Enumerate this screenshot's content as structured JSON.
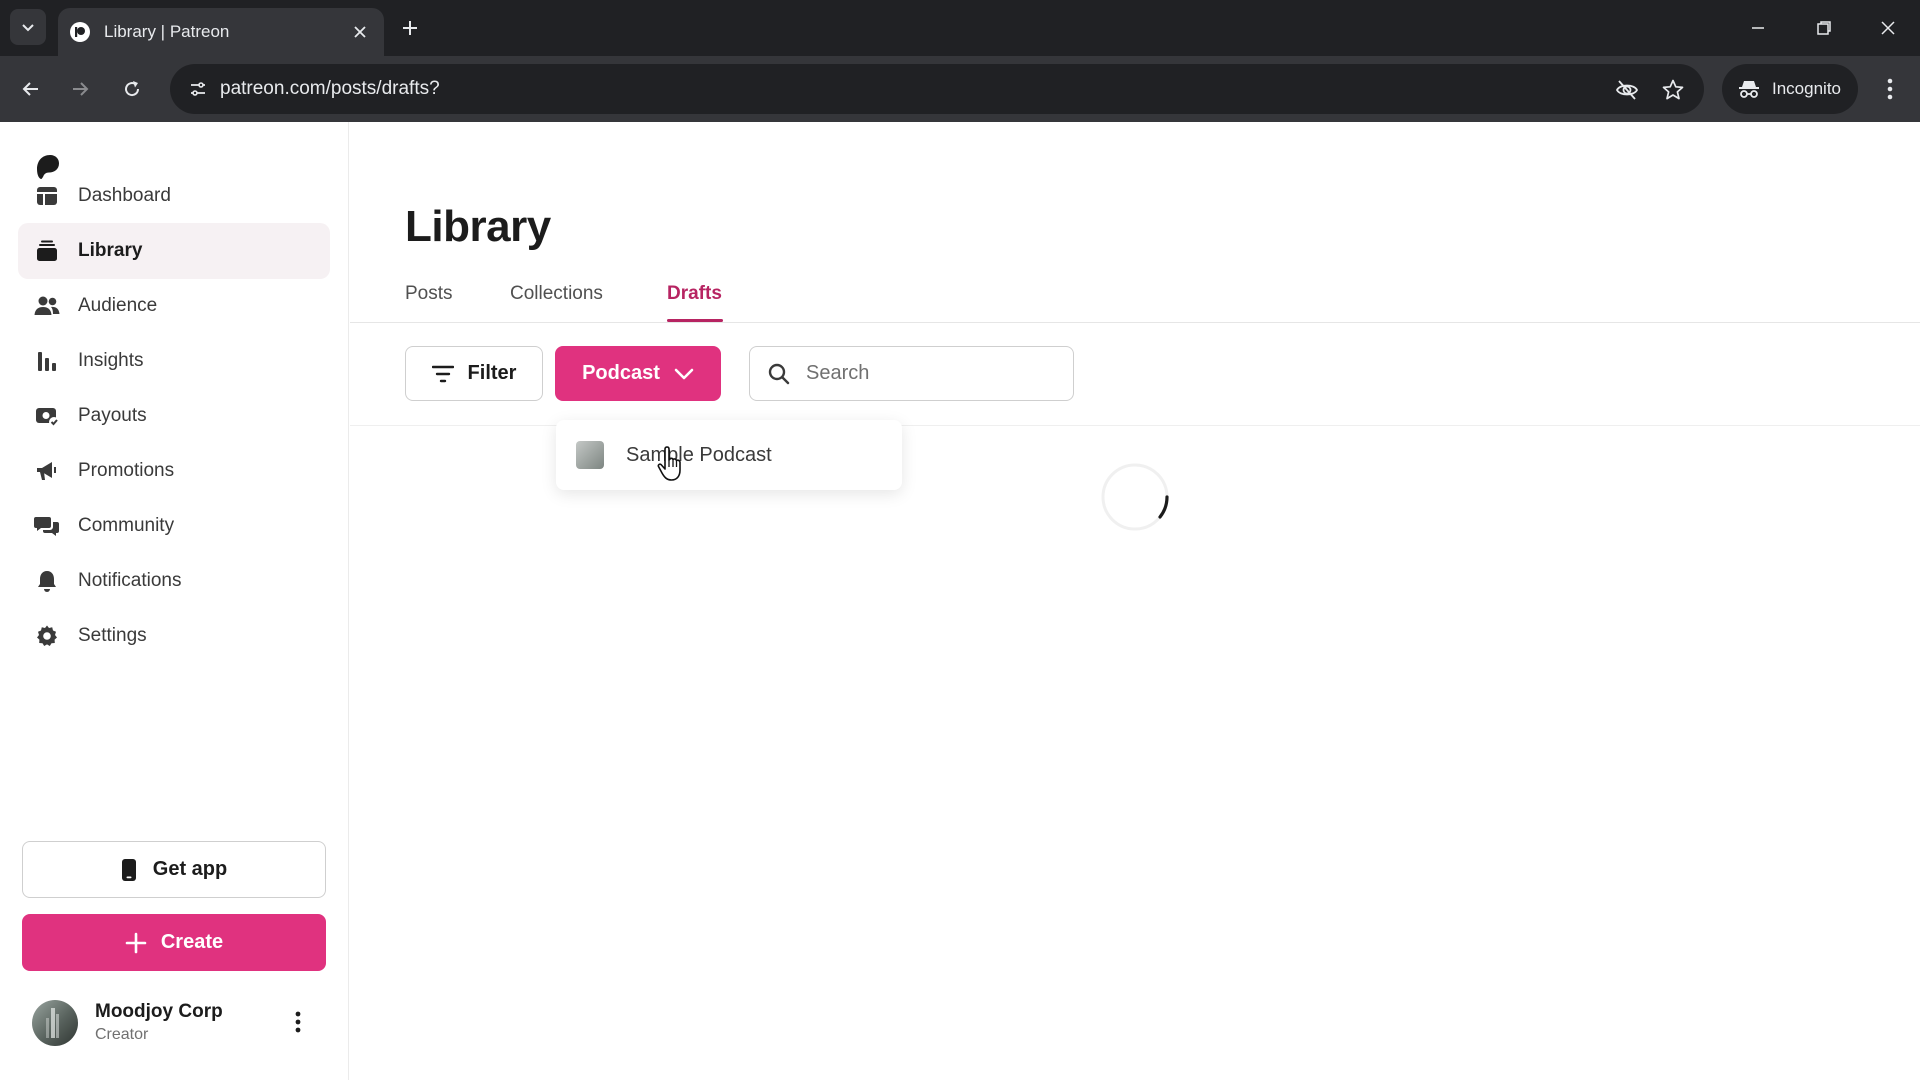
{
  "browser": {
    "tab_title": "Library | Patreon",
    "url": "patreon.com/posts/drafts?",
    "incognito_label": "Incognito"
  },
  "sidebar": {
    "items": [
      {
        "label": "Dashboard",
        "icon": "dashboard-icon",
        "active": false
      },
      {
        "label": "Library",
        "icon": "library-icon",
        "active": true
      },
      {
        "label": "Audience",
        "icon": "audience-icon",
        "active": false
      },
      {
        "label": "Insights",
        "icon": "insights-icon",
        "active": false
      },
      {
        "label": "Payouts",
        "icon": "payouts-icon",
        "active": false
      },
      {
        "label": "Promotions",
        "icon": "promotions-icon",
        "active": false
      },
      {
        "label": "Community",
        "icon": "community-icon",
        "active": false
      },
      {
        "label": "Notifications",
        "icon": "notifications-icon",
        "active": false
      },
      {
        "label": "Settings",
        "icon": "settings-icon",
        "active": false
      }
    ],
    "get_app_label": "Get app",
    "create_label": "Create",
    "user": {
      "name": "Moodjoy Corp",
      "role": "Creator"
    }
  },
  "main": {
    "title": "Library",
    "tabs": [
      {
        "label": "Posts",
        "active": false
      },
      {
        "label": "Collections",
        "active": false
      },
      {
        "label": "Drafts",
        "active": true
      }
    ],
    "filter_label": "Filter",
    "podcast_label": "Podcast",
    "search_placeholder": "Search",
    "dropdown": {
      "items": [
        {
          "label": "Sample Podcast"
        }
      ]
    }
  },
  "colors": {
    "accent": "#e0327f",
    "active_tab": "#b72462",
    "chrome_dark": "#202124",
    "chrome_mid": "#35363a"
  }
}
